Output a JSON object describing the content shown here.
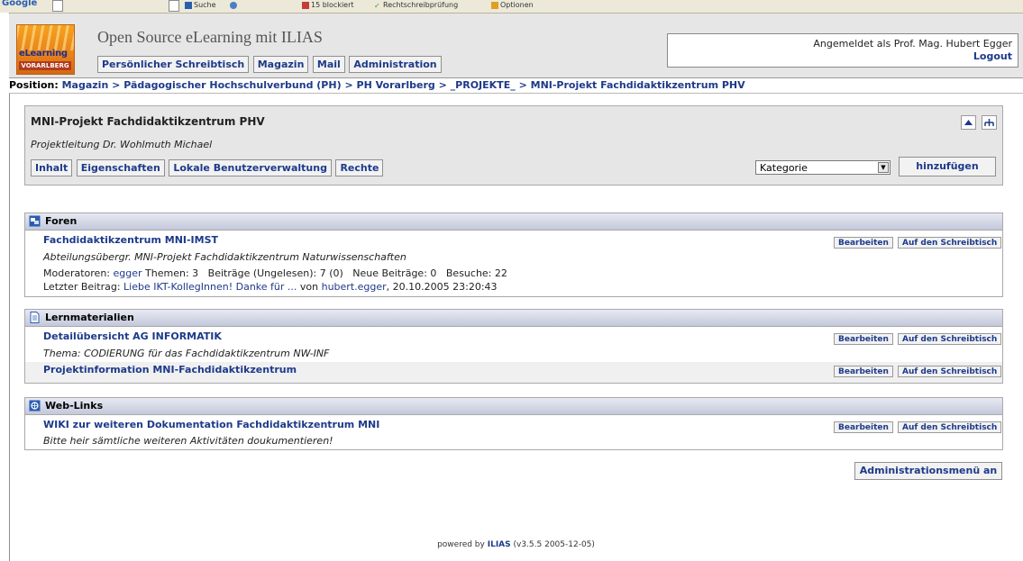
{
  "browser_toolbar": {
    "google": "Google",
    "search": "Suche",
    "blocked": "15 blockiert",
    "spellcheck": "Rechtschreibprüfung",
    "options": "Optionen"
  },
  "header": {
    "logo_top": "eLearning",
    "logo_bottom": "VORARLBERG",
    "site_title": "Open Source eLearning mit ILIAS",
    "nav": [
      "Persönlicher Schreibtisch",
      "Magazin",
      "Mail",
      "Administration"
    ],
    "user_text": "Angemeldet als Prof. Mag. Hubert Egger",
    "logout": "Logout"
  },
  "locator": {
    "label": "Position:",
    "crumbs": [
      "Magazin",
      "Pädagogischer Hochschulverbund (PH)",
      "PH Vorarlberg",
      "_PROJEKTE_",
      "MNI-Projekt Fachdidaktikzentrum PHV"
    ],
    "separator": ">"
  },
  "object": {
    "title": "MNI-Projekt Fachdidaktikzentrum PHV",
    "description": "Projektleitung Dr. Wohlmuth Michael",
    "tabs": [
      "Inhalt",
      "Eigenschaften",
      "Lokale Benutzerverwaltung",
      "Rechte"
    ],
    "select_value": "Kategorie",
    "add_label": "hinzufügen"
  },
  "item_buttons": {
    "edit": "Bearbeiten",
    "desktop": "Auf den Schreibtisch"
  },
  "blocks": {
    "forums": {
      "title": "Foren",
      "item_title": "Fachdidaktikzentrum MNI-IMST",
      "item_desc": "Abteilungsübergr. MNI-Projekt Fachdidaktikzentrum Naturwissenschaften",
      "moderators_label": "Moderatoren:",
      "moderator": "egger",
      "stats": "Themen: 3   Beiträge (Ungelesen): 7 (0)   Neue Beiträge: 0   Besuche: 22",
      "last_label": "Letzter Beitrag:",
      "last_post": "Liebe IKT-KollegInnen! Danke für ...",
      "from_label": "von",
      "last_author": "hubert.egger",
      "last_date": ", 20.10.2005 23:20:43"
    },
    "learning": {
      "title": "Lernmaterialien",
      "item1_title": "Detailübersicht AG INFORMATIK",
      "item1_desc": "Thema: CODIERUNG für das Fachdidaktikzentrum NW-INF",
      "item2_title": "Projektinformation MNI-Fachdidaktikzentrum"
    },
    "weblinks": {
      "title": "Web-Links",
      "item_title": "WIKI zur weiteren Dokumentation Fachdidaktikzentrum MNI",
      "item_desc": "Bitte heir sämtliche weiteren Aktivitäten doukumentieren!"
    }
  },
  "admin_menu": "Administrationsmenü an",
  "footer": {
    "prefix": "powered by",
    "brand": "ILIAS",
    "version": "(v3.5.5 2005-12-05)"
  }
}
